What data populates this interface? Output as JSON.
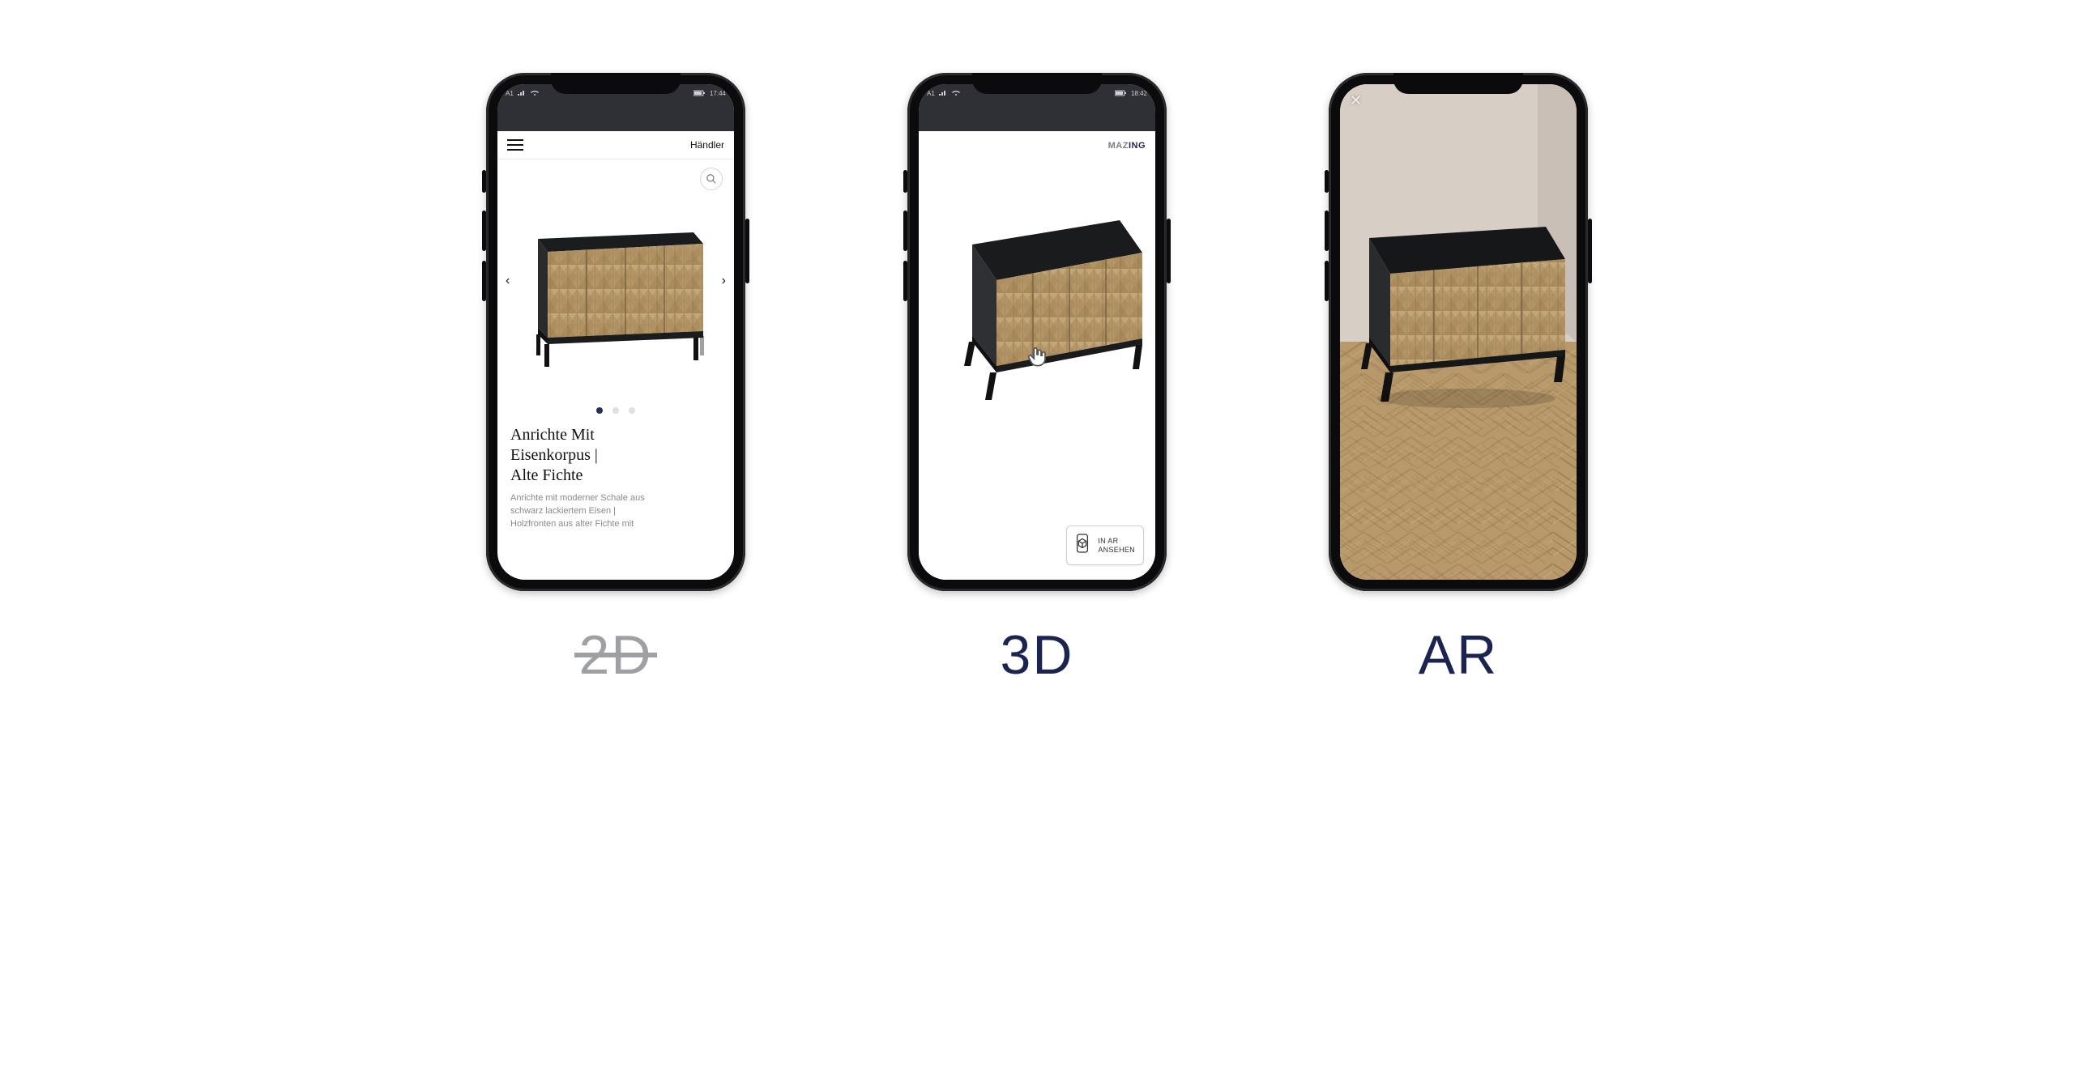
{
  "captions": {
    "c1": "2D",
    "c2": "3D",
    "c3": "AR"
  },
  "status": {
    "carrier": "A1",
    "time1": "17:44",
    "time2": "18:42"
  },
  "phone1": {
    "handler_label": "Händler",
    "title_l1": "Anrichte Mit",
    "title_l2": "Eisenkorpus |",
    "title_l3": "Alte Fichte",
    "desc_l1": "Anrichte mit moderner Schale aus",
    "desc_l2": "schwarz lackiertem Eisen |",
    "desc_l3": "Holzfronten aus alter Fichte mit"
  },
  "phone2": {
    "brand_a": "MAZ",
    "brand_b": "ING",
    "ar_l1": "IN AR",
    "ar_l2": "ANSEHEN"
  }
}
